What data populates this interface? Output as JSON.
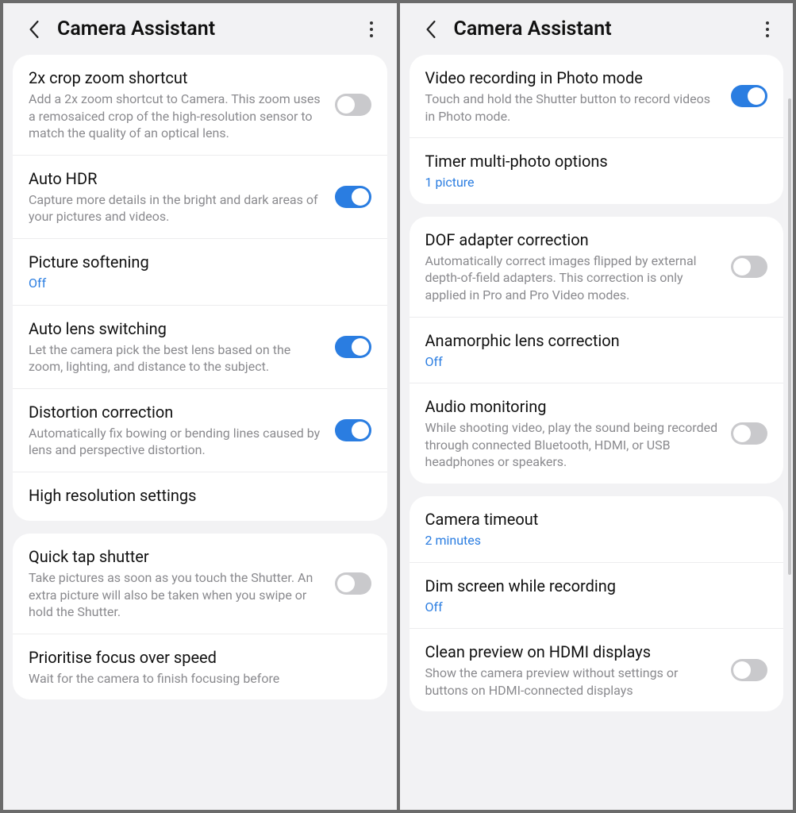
{
  "left": {
    "title": "Camera Assistant",
    "groups": [
      {
        "rows": [
          {
            "id": "crop-zoom",
            "title": "2x crop zoom shortcut",
            "desc": "Add a 2x zoom shortcut to Camera. This zoom uses a remosaiced crop of the high-resolution sensor to match the quality of an optical lens.",
            "toggle": false
          },
          {
            "id": "auto-hdr",
            "title": "Auto HDR",
            "desc": "Capture more details in the bright and dark areas of your pictures and videos.",
            "toggle": true
          },
          {
            "id": "picture-soft",
            "title": "Picture softening",
            "value": "Off"
          },
          {
            "id": "auto-lens",
            "title": "Auto lens switching",
            "desc": "Let the camera pick the best lens based on the zoom, lighting, and distance to the subject.",
            "toggle": true
          },
          {
            "id": "distortion",
            "title": "Distortion correction",
            "desc": "Automatically fix bowing or bending lines caused by lens and perspective distortion.",
            "toggle": true
          },
          {
            "id": "high-res",
            "title": "High resolution settings"
          }
        ]
      },
      {
        "rows": [
          {
            "id": "quick-tap",
            "title": "Quick tap shutter",
            "desc": "Take pictures as soon as you touch the Shutter. An extra picture will also be taken when you swipe or hold the Shutter.",
            "toggle": false
          },
          {
            "id": "prioritise-focus",
            "title": "Prioritise focus over speed",
            "desc": "Wait for the camera to finish focusing before"
          }
        ]
      }
    ]
  },
  "right": {
    "title": "Camera Assistant",
    "groups": [
      {
        "rows": [
          {
            "id": "video-photo",
            "title": "Video recording in Photo mode",
            "desc": "Touch and hold the Shutter button to record videos in Photo mode.",
            "toggle": true
          },
          {
            "id": "timer-multi",
            "title": "Timer multi-photo options",
            "value": "1 picture"
          }
        ]
      },
      {
        "rows": [
          {
            "id": "dof-adapter",
            "title": "DOF adapter correction",
            "desc": "Automatically correct images flipped by external depth-of-field adapters. This correction is only applied in Pro and Pro Video modes.",
            "toggle": false
          },
          {
            "id": "anamorphic",
            "title": "Anamorphic lens correction",
            "value": "Off"
          },
          {
            "id": "audio-mon",
            "title": "Audio monitoring",
            "desc": "While shooting video, play the sound being recorded through connected Bluetooth, HDMI, or USB headphones or speakers.",
            "toggle": false
          }
        ]
      },
      {
        "rows": [
          {
            "id": "cam-timeout",
            "title": "Camera timeout",
            "value": "2 minutes"
          },
          {
            "id": "dim-screen",
            "title": "Dim screen while recording",
            "value": "Off"
          },
          {
            "id": "clean-preview",
            "title": "Clean preview on HDMI displays",
            "desc": "Show the camera preview without settings or buttons on HDMI-connected displays",
            "toggle": false
          }
        ]
      }
    ]
  }
}
